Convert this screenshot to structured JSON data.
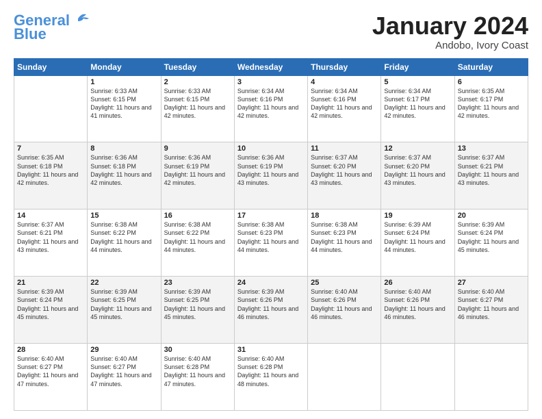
{
  "logo": {
    "line1": "General",
    "line2": "Blue",
    "alt": "GeneralBlue"
  },
  "header": {
    "month": "January 2024",
    "location": "Andobo, Ivory Coast"
  },
  "weekdays": [
    "Sunday",
    "Monday",
    "Tuesday",
    "Wednesday",
    "Thursday",
    "Friday",
    "Saturday"
  ],
  "weeks": [
    [
      {
        "day": "",
        "sunrise": "",
        "sunset": "",
        "daylight": ""
      },
      {
        "day": "1",
        "sunrise": "Sunrise: 6:33 AM",
        "sunset": "Sunset: 6:15 PM",
        "daylight": "Daylight: 11 hours and 41 minutes."
      },
      {
        "day": "2",
        "sunrise": "Sunrise: 6:33 AM",
        "sunset": "Sunset: 6:15 PM",
        "daylight": "Daylight: 11 hours and 42 minutes."
      },
      {
        "day": "3",
        "sunrise": "Sunrise: 6:34 AM",
        "sunset": "Sunset: 6:16 PM",
        "daylight": "Daylight: 11 hours and 42 minutes."
      },
      {
        "day": "4",
        "sunrise": "Sunrise: 6:34 AM",
        "sunset": "Sunset: 6:16 PM",
        "daylight": "Daylight: 11 hours and 42 minutes."
      },
      {
        "day": "5",
        "sunrise": "Sunrise: 6:34 AM",
        "sunset": "Sunset: 6:17 PM",
        "daylight": "Daylight: 11 hours and 42 minutes."
      },
      {
        "day": "6",
        "sunrise": "Sunrise: 6:35 AM",
        "sunset": "Sunset: 6:17 PM",
        "daylight": "Daylight: 11 hours and 42 minutes."
      }
    ],
    [
      {
        "day": "7",
        "sunrise": "Sunrise: 6:35 AM",
        "sunset": "Sunset: 6:18 PM",
        "daylight": "Daylight: 11 hours and 42 minutes."
      },
      {
        "day": "8",
        "sunrise": "Sunrise: 6:36 AM",
        "sunset": "Sunset: 6:18 PM",
        "daylight": "Daylight: 11 hours and 42 minutes."
      },
      {
        "day": "9",
        "sunrise": "Sunrise: 6:36 AM",
        "sunset": "Sunset: 6:19 PM",
        "daylight": "Daylight: 11 hours and 42 minutes."
      },
      {
        "day": "10",
        "sunrise": "Sunrise: 6:36 AM",
        "sunset": "Sunset: 6:19 PM",
        "daylight": "Daylight: 11 hours and 43 minutes."
      },
      {
        "day": "11",
        "sunrise": "Sunrise: 6:37 AM",
        "sunset": "Sunset: 6:20 PM",
        "daylight": "Daylight: 11 hours and 43 minutes."
      },
      {
        "day": "12",
        "sunrise": "Sunrise: 6:37 AM",
        "sunset": "Sunset: 6:20 PM",
        "daylight": "Daylight: 11 hours and 43 minutes."
      },
      {
        "day": "13",
        "sunrise": "Sunrise: 6:37 AM",
        "sunset": "Sunset: 6:21 PM",
        "daylight": "Daylight: 11 hours and 43 minutes."
      }
    ],
    [
      {
        "day": "14",
        "sunrise": "Sunrise: 6:37 AM",
        "sunset": "Sunset: 6:21 PM",
        "daylight": "Daylight: 11 hours and 43 minutes."
      },
      {
        "day": "15",
        "sunrise": "Sunrise: 6:38 AM",
        "sunset": "Sunset: 6:22 PM",
        "daylight": "Daylight: 11 hours and 44 minutes."
      },
      {
        "day": "16",
        "sunrise": "Sunrise: 6:38 AM",
        "sunset": "Sunset: 6:22 PM",
        "daylight": "Daylight: 11 hours and 44 minutes."
      },
      {
        "day": "17",
        "sunrise": "Sunrise: 6:38 AM",
        "sunset": "Sunset: 6:23 PM",
        "daylight": "Daylight: 11 hours and 44 minutes."
      },
      {
        "day": "18",
        "sunrise": "Sunrise: 6:38 AM",
        "sunset": "Sunset: 6:23 PM",
        "daylight": "Daylight: 11 hours and 44 minutes."
      },
      {
        "day": "19",
        "sunrise": "Sunrise: 6:39 AM",
        "sunset": "Sunset: 6:24 PM",
        "daylight": "Daylight: 11 hours and 44 minutes."
      },
      {
        "day": "20",
        "sunrise": "Sunrise: 6:39 AM",
        "sunset": "Sunset: 6:24 PM",
        "daylight": "Daylight: 11 hours and 45 minutes."
      }
    ],
    [
      {
        "day": "21",
        "sunrise": "Sunrise: 6:39 AM",
        "sunset": "Sunset: 6:24 PM",
        "daylight": "Daylight: 11 hours and 45 minutes."
      },
      {
        "day": "22",
        "sunrise": "Sunrise: 6:39 AM",
        "sunset": "Sunset: 6:25 PM",
        "daylight": "Daylight: 11 hours and 45 minutes."
      },
      {
        "day": "23",
        "sunrise": "Sunrise: 6:39 AM",
        "sunset": "Sunset: 6:25 PM",
        "daylight": "Daylight: 11 hours and 45 minutes."
      },
      {
        "day": "24",
        "sunrise": "Sunrise: 6:39 AM",
        "sunset": "Sunset: 6:26 PM",
        "daylight": "Daylight: 11 hours and 46 minutes."
      },
      {
        "day": "25",
        "sunrise": "Sunrise: 6:40 AM",
        "sunset": "Sunset: 6:26 PM",
        "daylight": "Daylight: 11 hours and 46 minutes."
      },
      {
        "day": "26",
        "sunrise": "Sunrise: 6:40 AM",
        "sunset": "Sunset: 6:26 PM",
        "daylight": "Daylight: 11 hours and 46 minutes."
      },
      {
        "day": "27",
        "sunrise": "Sunrise: 6:40 AM",
        "sunset": "Sunset: 6:27 PM",
        "daylight": "Daylight: 11 hours and 46 minutes."
      }
    ],
    [
      {
        "day": "28",
        "sunrise": "Sunrise: 6:40 AM",
        "sunset": "Sunset: 6:27 PM",
        "daylight": "Daylight: 11 hours and 47 minutes."
      },
      {
        "day": "29",
        "sunrise": "Sunrise: 6:40 AM",
        "sunset": "Sunset: 6:27 PM",
        "daylight": "Daylight: 11 hours and 47 minutes."
      },
      {
        "day": "30",
        "sunrise": "Sunrise: 6:40 AM",
        "sunset": "Sunset: 6:28 PM",
        "daylight": "Daylight: 11 hours and 47 minutes."
      },
      {
        "day": "31",
        "sunrise": "Sunrise: 6:40 AM",
        "sunset": "Sunset: 6:28 PM",
        "daylight": "Daylight: 11 hours and 48 minutes."
      },
      {
        "day": "",
        "sunrise": "",
        "sunset": "",
        "daylight": ""
      },
      {
        "day": "",
        "sunrise": "",
        "sunset": "",
        "daylight": ""
      },
      {
        "day": "",
        "sunrise": "",
        "sunset": "",
        "daylight": ""
      }
    ]
  ]
}
